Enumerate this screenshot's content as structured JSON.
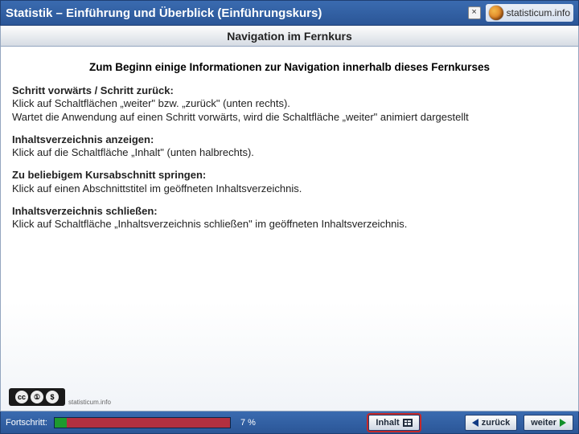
{
  "header": {
    "title": "Statistik – Einführung und Überblick (Einführungskurs)",
    "close_label": "×",
    "brand": "statisticum.info"
  },
  "section_title": "Navigation im Fernkurs",
  "intro": "Zum Beginn einige Informationen zur Navigation innerhalb dieses Fernkurses",
  "paragraphs": [
    {
      "heading": "Schritt vorwärts / Schritt zurück:",
      "body1": "Klick auf Schaltflächen „weiter\" bzw. „zurück\" (unten rechts).",
      "body2": "Wartet die Anwendung auf einen Schritt vorwärts, wird die Schaltfläche „weiter\" animiert dargestellt"
    },
    {
      "heading": "Inhaltsverzeichnis anzeigen:",
      "body1": "Klick auf die Schaltfläche „Inhalt\" (unten halbrechts).",
      "body2": ""
    },
    {
      "heading": "Zu beliebigem Kursabschnitt springen:",
      "body1": "Klick auf einen Abschnittstitel im geöffneten Inhaltsverzeichnis.",
      "body2": ""
    },
    {
      "heading": "Inhaltsverzeichnis schließen:",
      "body1": "Klick auf Schaltfläche „Inhaltsverzeichnis schließen\" im geöffneten Inhaltsverzeichnis.",
      "body2": ""
    }
  ],
  "cc": {
    "c1": "cc",
    "c2": "①",
    "c3": "$",
    "caption": "statisticum.info"
  },
  "footer": {
    "progress_label": "Fortschritt:",
    "progress_pct_text": "7 %",
    "progress_pct_value": 7,
    "toc_label": "Inhalt",
    "back_label": "zurück",
    "next_label": "weiter"
  }
}
